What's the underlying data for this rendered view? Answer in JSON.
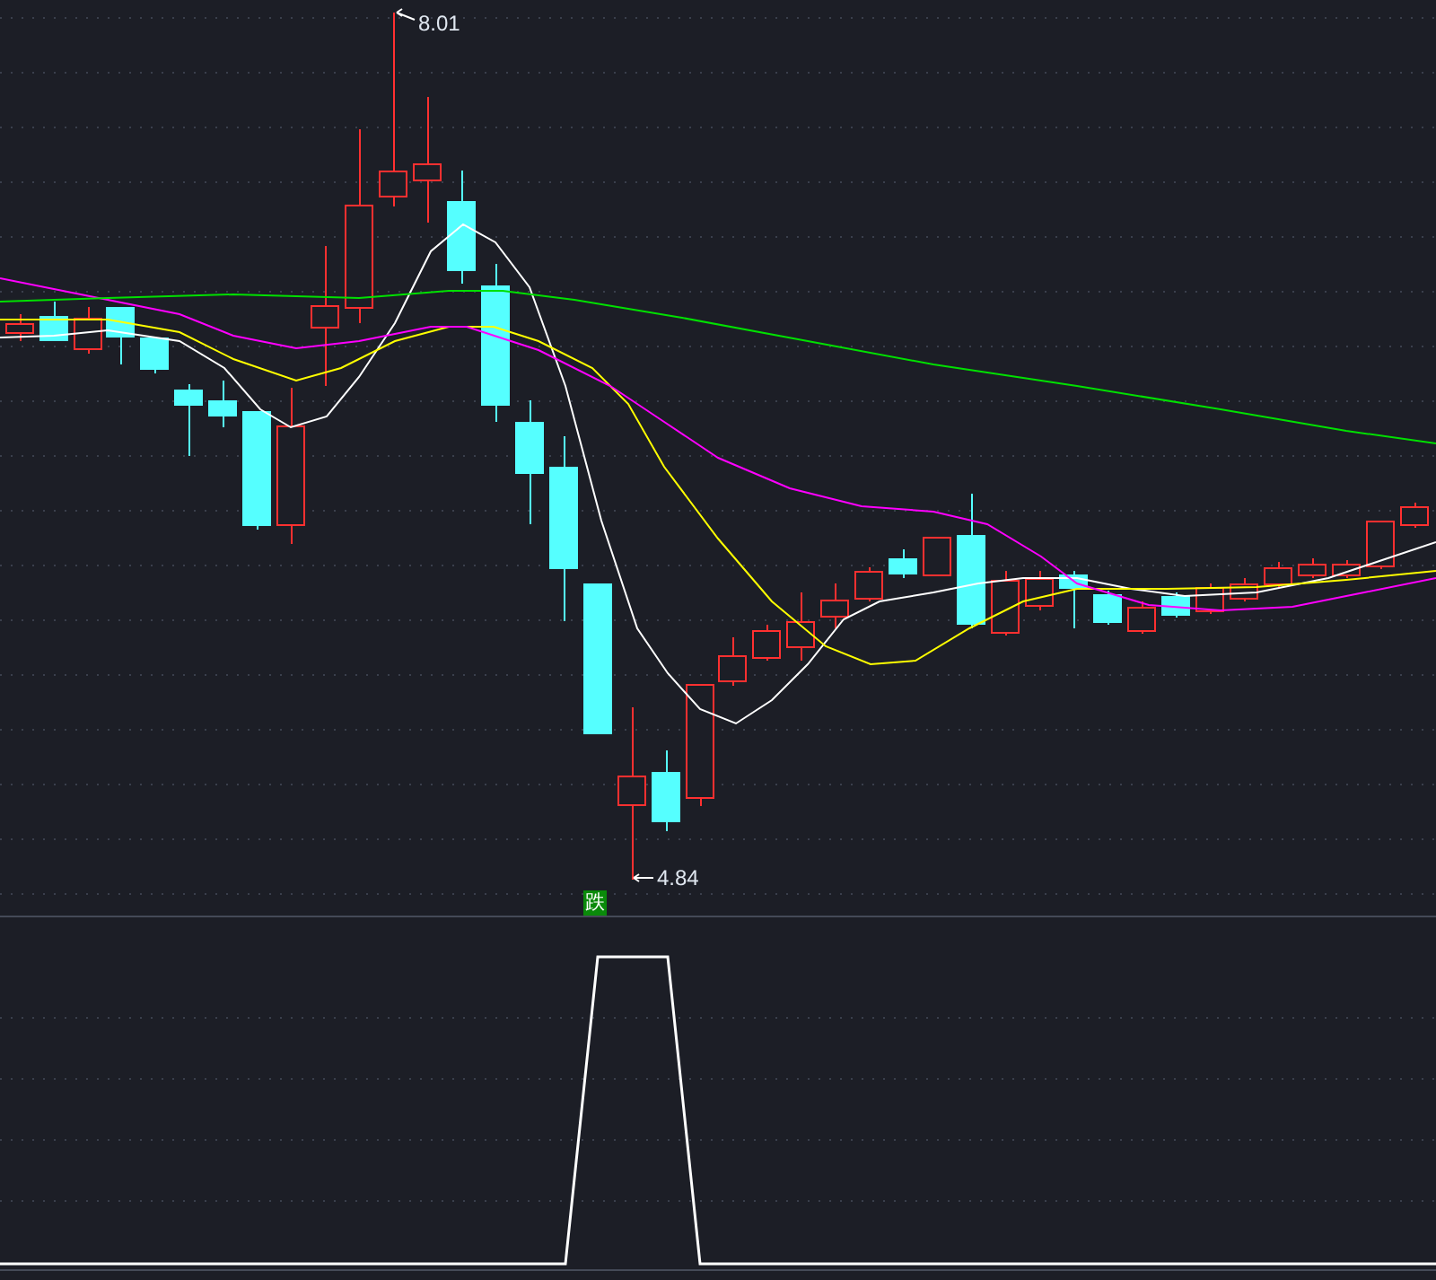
{
  "price_chart": {
    "high_label": "8.01",
    "low_label": "4.84",
    "signal_label": "跌"
  }
}
